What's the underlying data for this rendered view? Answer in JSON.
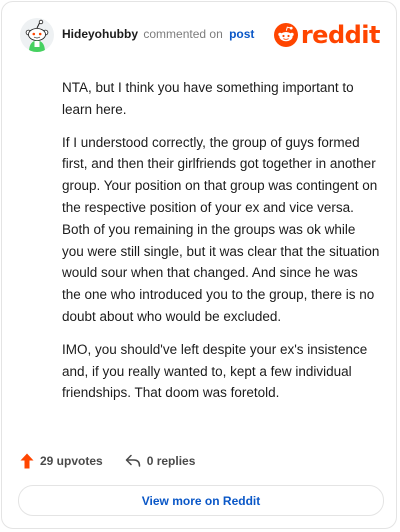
{
  "header": {
    "username": "Hideyohubby",
    "action_text": "commented on",
    "post_link": "post",
    "brand_name": "reddit",
    "brand_color": "#ff4500",
    "avatar_icon": "reddit-snoo-avatar-icon",
    "logo_icon": "reddit-snoo-logo-icon"
  },
  "comment": {
    "paragraphs": [
      "NTA, but I think you have something important to learn here.",
      "If I understood correctly, the group of guys formed first, and then their girlfriends got together in another group. Your position on that group was contingent on the respective position of your ex and vice versa. Both of you remaining in the groups was ok while you were still single, but it was clear that the situation would sour when that changed. And since he was the one who introduced you to the group, there is no doubt about who would be excluded.",
      "IMO, you should've left despite your ex's insistence and, if you really wanted to, kept a few individual friendships. That doom was foretold."
    ]
  },
  "stats": {
    "upvotes_label": "29 upvotes",
    "upvote_icon": "upvote-arrow-icon",
    "upvote_color": "#ff4500",
    "replies_label": "0 replies",
    "reply_icon": "reply-arrow-icon"
  },
  "footer": {
    "view_more_label": "View more on Reddit",
    "link_color": "#0a57c7"
  }
}
